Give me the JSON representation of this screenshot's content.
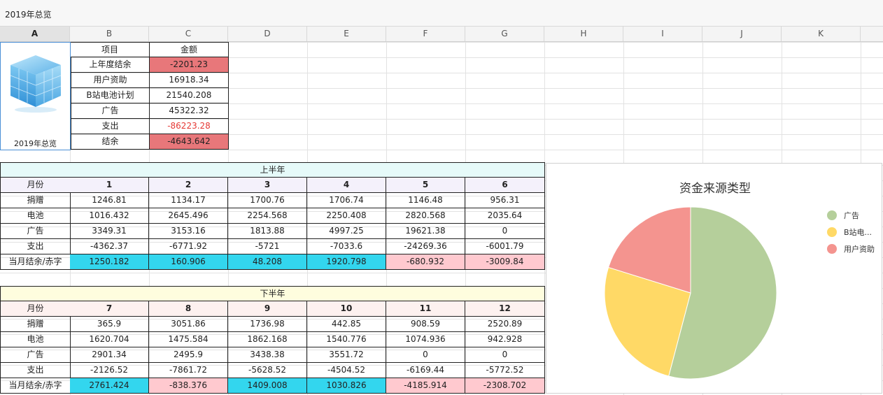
{
  "sheet_title": "2019年总览",
  "columns": [
    "A",
    "B",
    "C",
    "D",
    "E",
    "F",
    "G",
    "H",
    "I",
    "J",
    "K"
  ],
  "image_caption": "2019年总览",
  "summary": {
    "header": [
      "项目",
      "金额"
    ],
    "rows": [
      {
        "label": "上年度结余",
        "value": "-2201.23",
        "style": "pink"
      },
      {
        "label": "用户资助",
        "value": "16918.34",
        "style": ""
      },
      {
        "label": "B站电池计划",
        "value": "21540.208",
        "style": ""
      },
      {
        "label": "广告",
        "value": "45322.32",
        "style": ""
      },
      {
        "label": "支出",
        "value": "-86223.28",
        "style": "red-text"
      },
      {
        "label": "结余",
        "value": "-4643.642",
        "style": "pink"
      }
    ]
  },
  "h1": {
    "title": "上半年",
    "title_bg": "#e6faf9",
    "header_bg": "#f4f1fb",
    "month_label": "月份",
    "months": [
      "1",
      "2",
      "3",
      "4",
      "5",
      "6"
    ],
    "rows": [
      {
        "label": "捐赠",
        "values": [
          "1246.81",
          "1134.17",
          "1700.76",
          "1706.74",
          "1146.48",
          "956.31"
        ]
      },
      {
        "label": "电池",
        "values": [
          "1016.432",
          "2645.496",
          "2254.568",
          "2250.408",
          "2820.568",
          "2035.64"
        ]
      },
      {
        "label": "广告",
        "values": [
          "3349.31",
          "3153.16",
          "1813.88",
          "4997.25",
          "19621.38",
          "0"
        ]
      },
      {
        "label": "支出",
        "values": [
          "-4362.37",
          "-6771.92",
          "-5721",
          "-7033.6",
          "-24269.36",
          "-6001.79"
        ]
      }
    ],
    "balance_label": "当月结余/赤字",
    "balance": [
      "1250.182",
      "160.906",
      "48.208",
      "1920.798",
      "-680.932",
      "-3009.84"
    ],
    "balance_style": [
      "cyan",
      "cyan",
      "cyan",
      "cyan",
      "lpink",
      "lpink"
    ]
  },
  "h2": {
    "title": "下半年",
    "title_bg": "#fefdde",
    "header_bg": "#fdf1ef",
    "month_label": "月份",
    "months": [
      "7",
      "8",
      "9",
      "10",
      "11",
      "12"
    ],
    "rows": [
      {
        "label": "捐赠",
        "values": [
          "365.9",
          "3051.86",
          "1736.98",
          "442.85",
          "908.59",
          "2520.89"
        ]
      },
      {
        "label": "电池",
        "values": [
          "1620.704",
          "1475.584",
          "1862.168",
          "1540.776",
          "1074.936",
          "942.928"
        ]
      },
      {
        "label": "广告",
        "values": [
          "2901.34",
          "2495.9",
          "3438.38",
          "3551.72",
          "0",
          "0"
        ]
      },
      {
        "label": "支出",
        "values": [
          "-2126.52",
          "-7861.72",
          "-5628.52",
          "-4504.52",
          "-6169.44",
          "-5772.52"
        ]
      }
    ],
    "balance_label": "当月结余/赤字",
    "balance": [
      "2761.424",
      "-838.376",
      "1409.008",
      "1030.826",
      "-4185.914",
      "-2308.702"
    ],
    "balance_style": [
      "cyan",
      "lpink",
      "cyan",
      "cyan",
      "lpink",
      "lpink"
    ]
  },
  "chart_data": {
    "type": "pie",
    "title": "资金来源类型",
    "legend_position": "right",
    "slices": [
      {
        "name": "广告",
        "display_name": "广告",
        "value": 45322.32,
        "color": "#b5cf9b"
      },
      {
        "name": "B站电池计划",
        "display_name": "B站电...",
        "value": 21540.208,
        "color": "#ffd966"
      },
      {
        "name": "用户资助",
        "display_name": "用户资助",
        "value": 16918.34,
        "color": "#f4948f"
      }
    ]
  }
}
